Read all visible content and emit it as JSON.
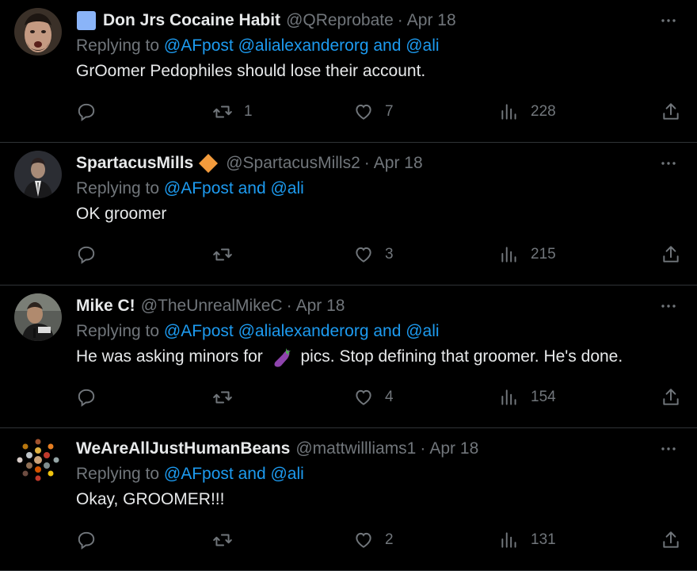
{
  "tweets": [
    {
      "name": "Don Jrs Cocaine Habit",
      "handle": "@QReprobate",
      "date": "Apr 18",
      "replying_prefix": "Replying to ",
      "replying_links": "@AFpost @alialexanderorg and @ali",
      "text": "GrOomer Pedophiles should lose their account.",
      "retweets": "1",
      "likes": "7",
      "views": "228"
    },
    {
      "name": "SpartacusMills",
      "handle": "@SpartacusMills2",
      "date": "Apr 18",
      "replying_prefix": "Replying to ",
      "replying_links": "@AFpost and @ali",
      "text": "OK groomer",
      "retweets": "",
      "likes": "3",
      "views": "215"
    },
    {
      "name": "Mike C!",
      "handle": "@TheUnrealMikeC",
      "date": "Apr 18",
      "replying_prefix": "Replying to ",
      "replying_links": "@AFpost @alialexanderorg and @ali",
      "text_before": "He was asking minors for",
      "text_after": "pics. Stop defining that groomer. He's done.",
      "retweets": "",
      "likes": "4",
      "views": "154"
    },
    {
      "name": "WeAreAllJustHumanBeans",
      "handle": "@mattwillliams1",
      "date": "Apr 18",
      "replying_prefix": "Replying to ",
      "replying_links": "@AFpost and @ali",
      "text": "Okay, GROOMER!!!",
      "retweets": "",
      "likes": "2",
      "views": "131"
    }
  ],
  "separator": "·",
  "colors": {
    "background": "#000000",
    "text": "#e7e9ea",
    "muted": "#71767b",
    "link": "#1d9bf0",
    "border": "#2f3336",
    "badge_blue": "#8ab4f8",
    "badge_orange": "#f39b3c"
  },
  "icons": [
    "reply-icon",
    "retweet-icon",
    "like-icon",
    "views-icon",
    "share-icon",
    "more-icon",
    "eggplant-emoji"
  ]
}
